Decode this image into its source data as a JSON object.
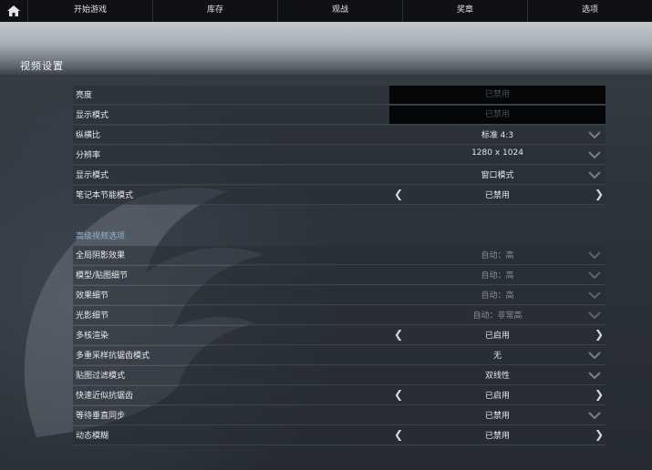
{
  "nav": {
    "home_icon": "home-icon",
    "items": [
      "开始游戏",
      "库存",
      "观战",
      "奖章",
      "选项"
    ]
  },
  "page_title": "视频设置",
  "basic": [
    {
      "label": "亮度",
      "value": "已禁用",
      "style": "boxed"
    },
    {
      "label": "显示模式",
      "value": "已禁用",
      "style": "boxed"
    },
    {
      "label": "纵横比",
      "value": "标准 4:3",
      "style": "dropdown"
    },
    {
      "label": "分辨率",
      "value": "1280 x 1024",
      "style": "dropdown"
    },
    {
      "label": "显示模式",
      "value": "窗口模式",
      "style": "dropdown"
    },
    {
      "label": "笔记本节能模式",
      "value": "已禁用",
      "style": "toggle"
    }
  ],
  "advanced_title": "高级视频选项",
  "advanced": [
    {
      "label": "全局阴影效果",
      "value": "自动：高",
      "style": "dropdown-dim"
    },
    {
      "label": "模型/贴图细节",
      "value": "自动：高",
      "style": "dropdown-dim"
    },
    {
      "label": "效果细节",
      "value": "自动：高",
      "style": "dropdown-dim"
    },
    {
      "label": "光影细节",
      "value": "自动：非常高",
      "style": "dropdown-dim"
    },
    {
      "label": "多核渲染",
      "value": "已启用",
      "style": "toggle"
    },
    {
      "label": "多重采样抗锯齿模式",
      "value": "无",
      "style": "dropdown"
    },
    {
      "label": "贴图过滤模式",
      "value": "双线性",
      "style": "dropdown"
    },
    {
      "label": "快速近似抗锯齿",
      "value": "已启用",
      "style": "toggle"
    },
    {
      "label": "等待垂直同步",
      "value": "已禁用",
      "style": "dropdown"
    },
    {
      "label": "动态模糊",
      "value": "已禁用",
      "style": "toggle"
    }
  ],
  "colors": {
    "accent": "#8fb7d6",
    "nav_bg": "#0f1114"
  }
}
